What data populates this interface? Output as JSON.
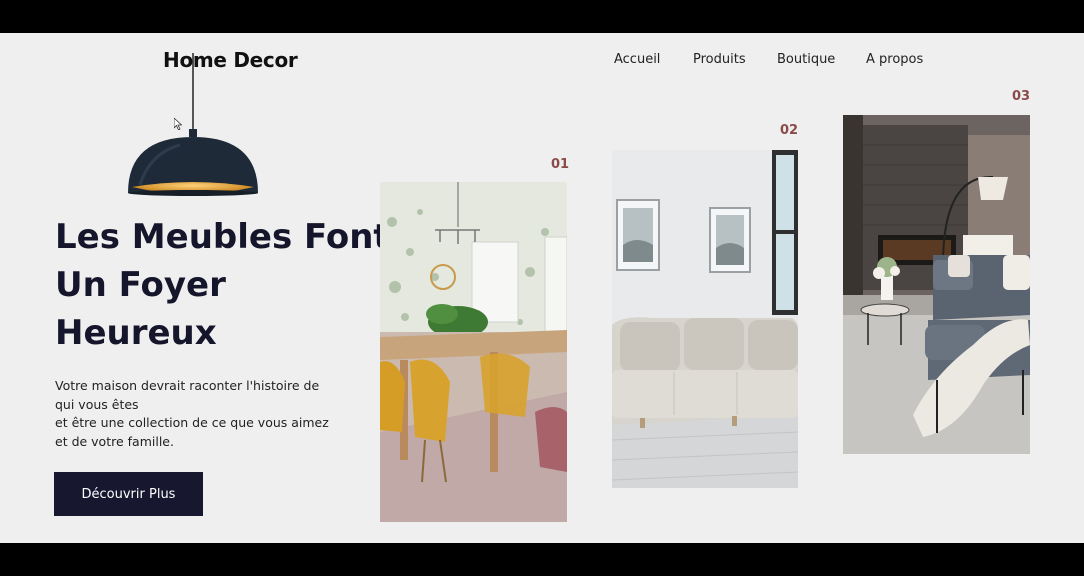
{
  "brand": {
    "logo": "Home Decor"
  },
  "nav": {
    "items": [
      "Accueil",
      "Produits",
      "Boutique",
      "A propos"
    ]
  },
  "hero": {
    "title_lines": [
      "Les Meubles Font",
      "Un Foyer",
      "Heureux"
    ],
    "description_lines": [
      "Votre maison devrait raconter l'histoire de",
      "qui vous êtes",
      "et être une collection de ce que vous aimez",
      "et de votre famille."
    ],
    "cta_label": "Découvrir Plus"
  },
  "gallery": {
    "items": [
      {
        "number": "01",
        "image": "dining-room-photo"
      },
      {
        "number": "02",
        "image": "living-room-sofa-photo"
      },
      {
        "number": "03",
        "image": "lounge-fireplace-photo"
      }
    ]
  },
  "colors": {
    "background": "#efefef",
    "heading": "#15152b",
    "button": "#171730",
    "number_accent": "#8b4a4a",
    "lamp_shade": "#1f2a38",
    "lamp_glow": "#e8a93a"
  },
  "icons": {
    "lamp": "pendant-lamp-icon",
    "cursor": "mouse-cursor-icon"
  }
}
